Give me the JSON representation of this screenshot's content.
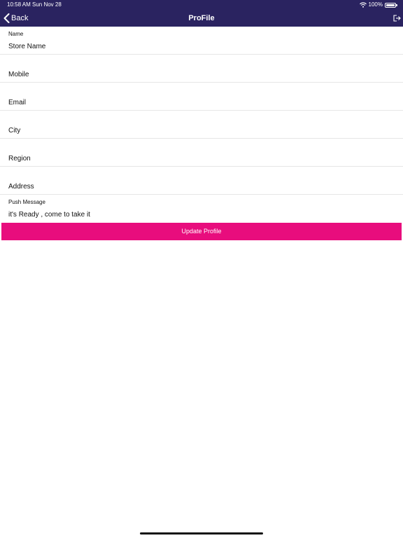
{
  "status_bar": {
    "time": "10:58 AM",
    "date": "Sun Nov 28",
    "battery": "100%",
    "wifi_icon": "wifi-icon",
    "battery_icon": "battery-icon"
  },
  "nav": {
    "back_label": "Back",
    "back_icon": "chevron-left-icon",
    "title": "ProFile",
    "logout_icon": "logout-icon",
    "bar_color": "#2a2360"
  },
  "form": {
    "name_label": "Name",
    "store_name_placeholder": "Store Name",
    "mobile_placeholder": "Mobile",
    "email_placeholder": "Email",
    "city_placeholder": "City",
    "region_placeholder": "Region",
    "address_placeholder": "Address",
    "push_message_label": "Push Message",
    "push_message_value": "it's Ready , come to take it"
  },
  "update_button": {
    "label": "Update Profile",
    "color": "#e80d7d"
  }
}
